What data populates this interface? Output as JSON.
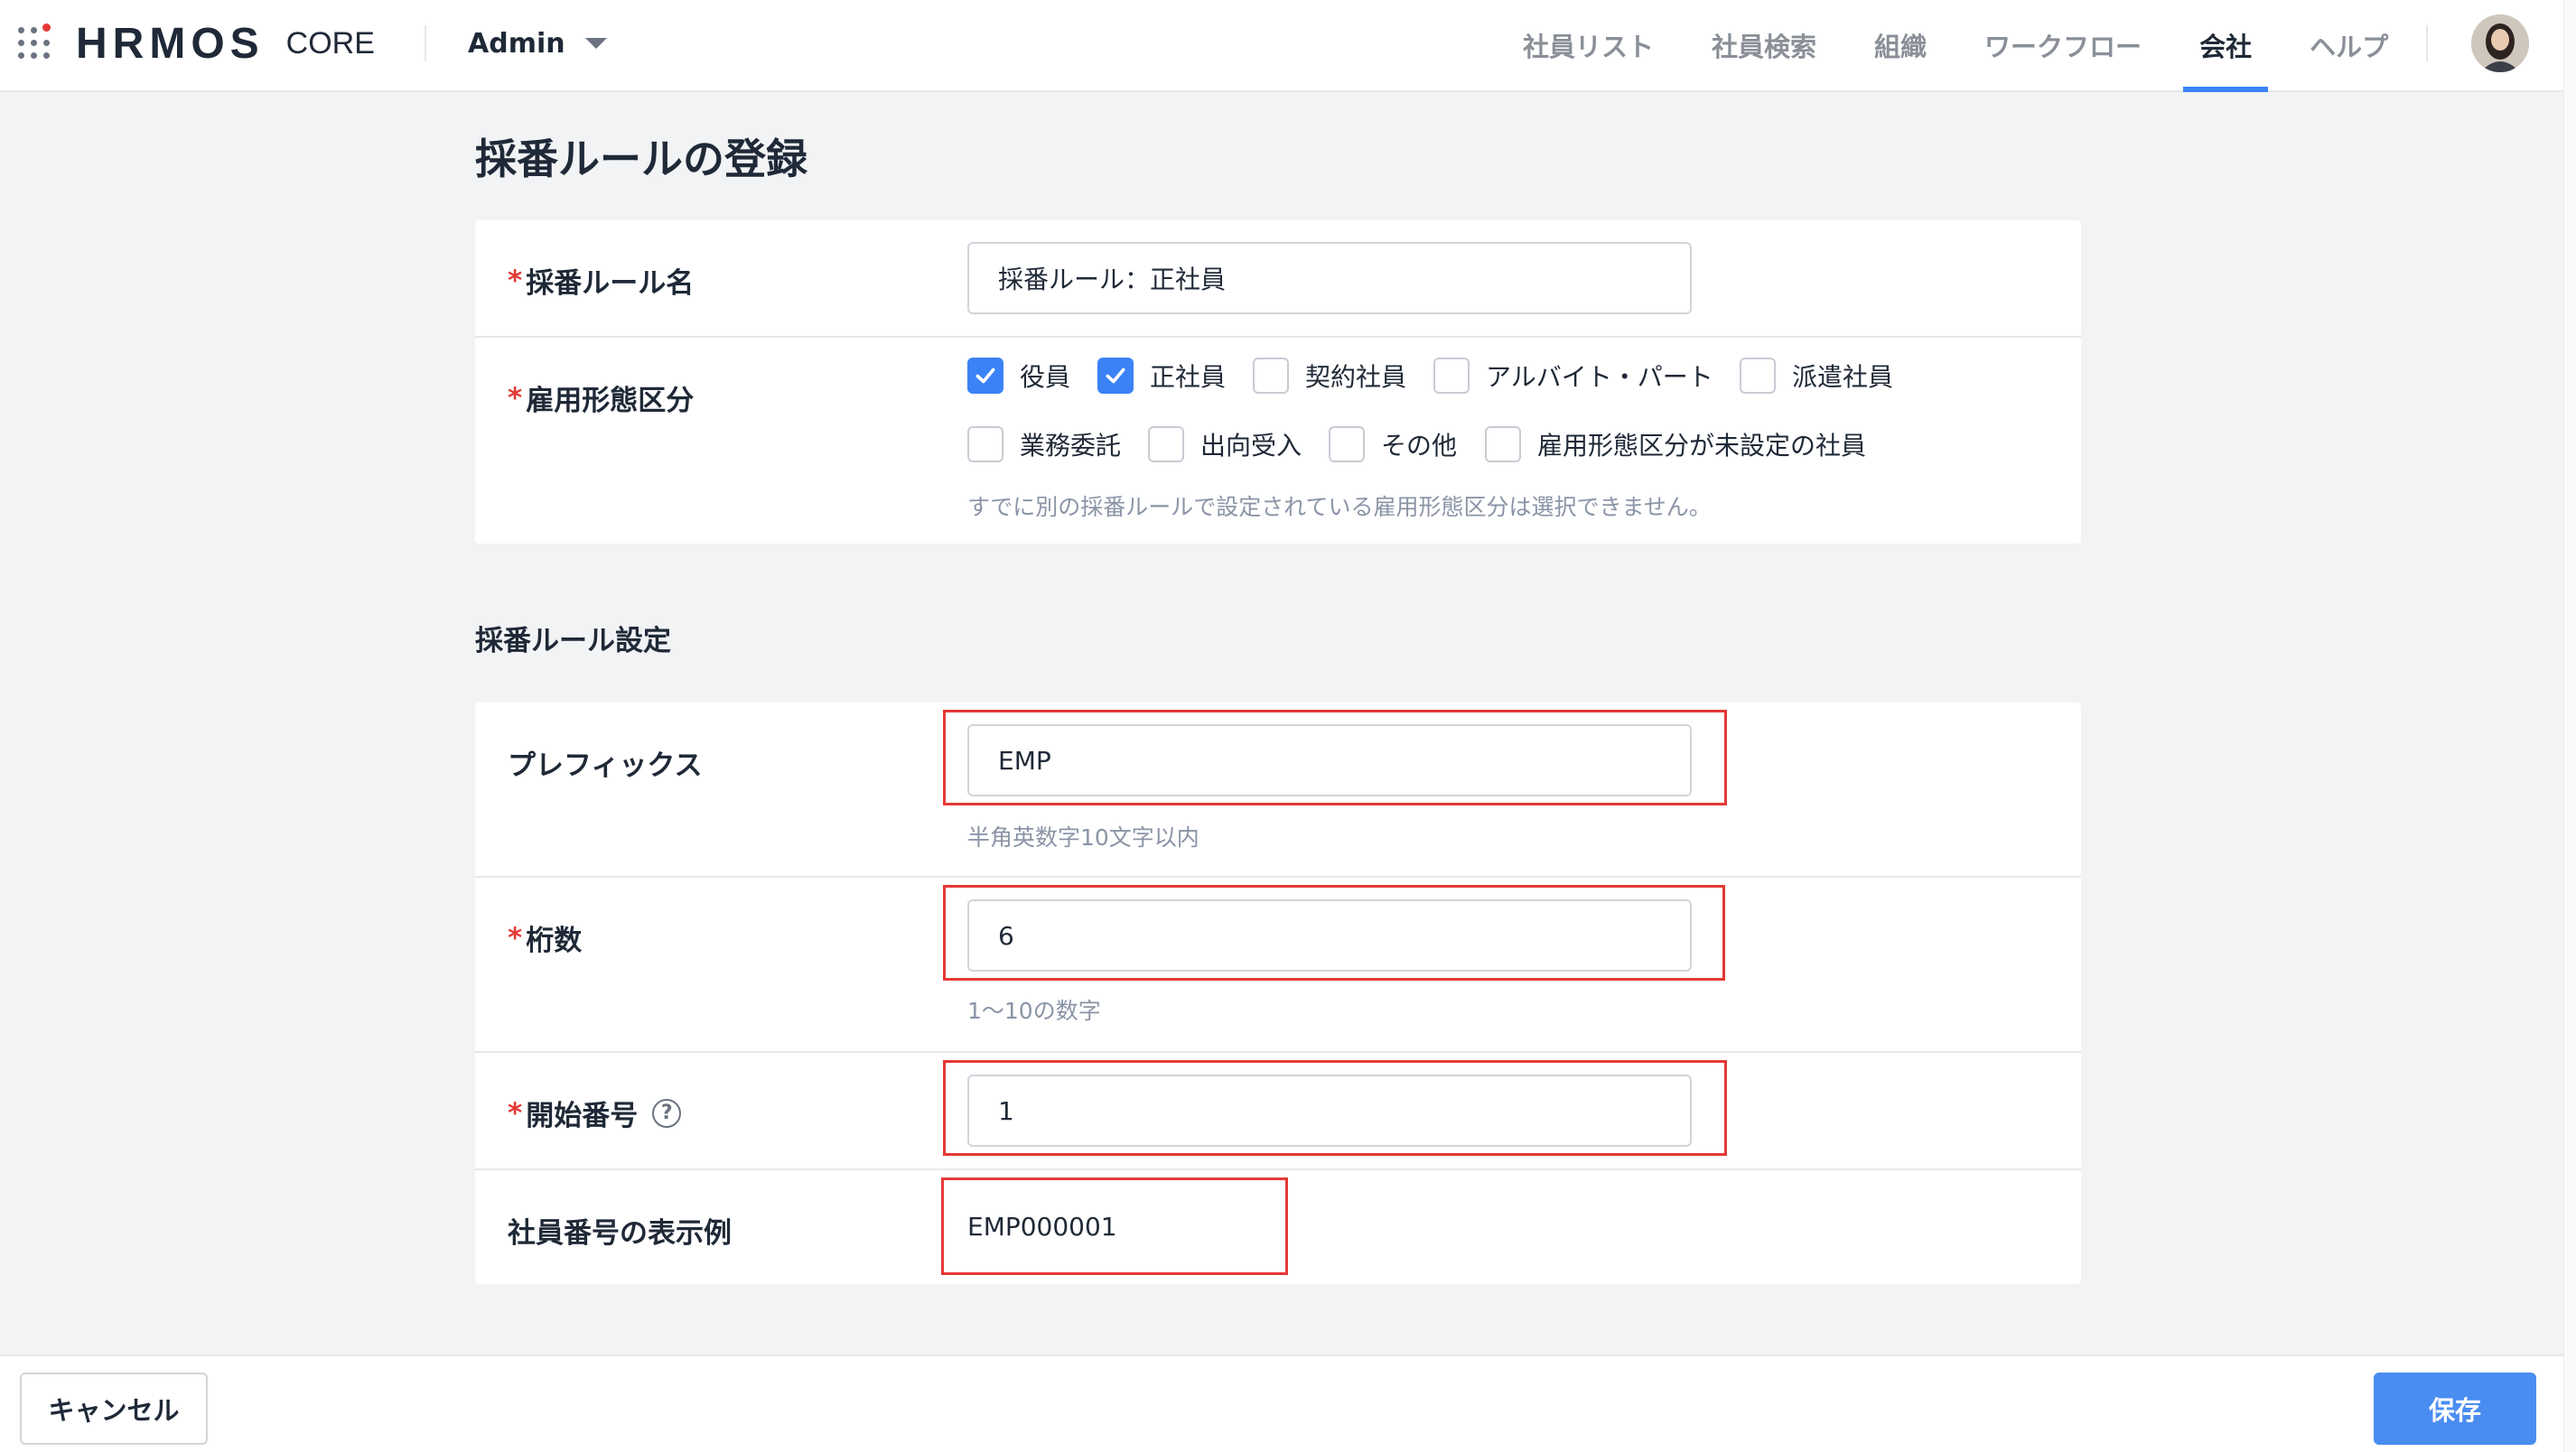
{
  "app": {
    "logo": "HRMOS",
    "logo_sub": "CORE",
    "tenant": "Admin"
  },
  "nav": [
    {
      "label": "社員リスト",
      "active": false
    },
    {
      "label": "社員検索",
      "active": false
    },
    {
      "label": "組織",
      "active": false
    },
    {
      "label": "ワークフロー",
      "active": false
    },
    {
      "label": "会社",
      "active": true
    },
    {
      "label": "ヘルプ",
      "active": false
    }
  ],
  "page": {
    "title": "採番ルールの登録"
  },
  "basic": {
    "rule_name_label": "採番ルール名",
    "rule_name_value": "採番ルール：正社員",
    "employment_label": "雇用形態区分",
    "employment_options": [
      {
        "label": "役員",
        "checked": true
      },
      {
        "label": "正社員",
        "checked": true
      },
      {
        "label": "契約社員",
        "checked": false
      },
      {
        "label": "アルバイト・パート",
        "checked": false
      },
      {
        "label": "派遣社員",
        "checked": false
      },
      {
        "label": "業務委託",
        "checked": false
      },
      {
        "label": "出向受入",
        "checked": false
      },
      {
        "label": "その他",
        "checked": false
      },
      {
        "label": "雇用形態区分が未設定の社員",
        "checked": false
      }
    ],
    "employment_hint": "すでに別の採番ルールで設定されている雇用形態区分は選択できません。"
  },
  "settings": {
    "section_title": "採番ルール設定",
    "prefix_label": "プレフィックス",
    "prefix_value": "EMP",
    "prefix_hint": "半角英数字10文字以内",
    "digits_label": "桁数",
    "digits_value": "6",
    "digits_hint": "1〜10の数字",
    "start_label": "開始番号",
    "start_value": "1",
    "example_label": "社員番号の表示例",
    "example_value": "EMP000001"
  },
  "required_mark": "*",
  "help_glyph": "?",
  "footer": {
    "cancel_label": "キャンセル",
    "save_label": "保存"
  },
  "colors": {
    "accent": "#3b82f6",
    "save_button": "#4a8df0",
    "required": "#e53935",
    "highlight_box": "#e53935"
  },
  "icons": {
    "apps": "apps-grid-icon",
    "dropdown": "chevron-down-icon",
    "help": "help-circle-icon",
    "check": "check-icon"
  }
}
